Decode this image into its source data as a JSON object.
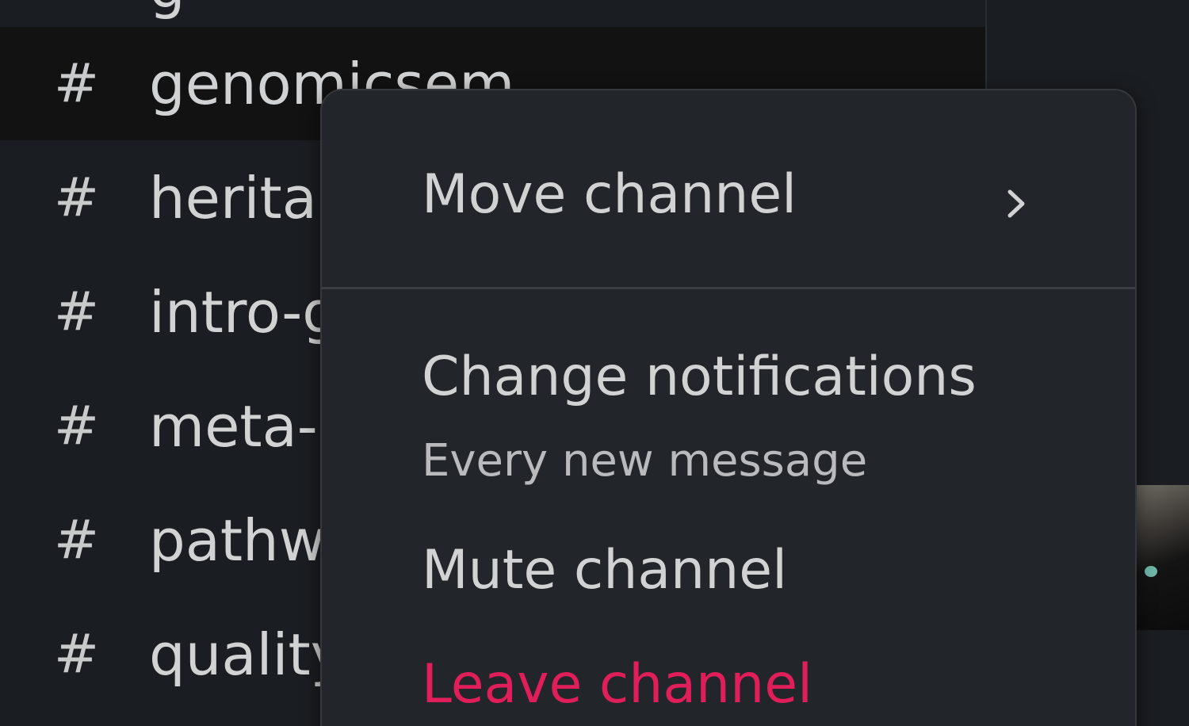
{
  "sidebar": {
    "partial_top_channel": "g",
    "channels": [
      {
        "hash": "#",
        "name": "genomicsem",
        "active": true
      },
      {
        "hash": "#",
        "name": "heritab"
      },
      {
        "hash": "#",
        "name": "intro-g"
      },
      {
        "hash": "#",
        "name": "meta-a"
      },
      {
        "hash": "#",
        "name": "pathwa"
      },
      {
        "hash": "#",
        "name": "quality"
      }
    ]
  },
  "context_menu": {
    "move_channel": "Move channel",
    "move_channel_icon": "chevron-right-icon",
    "change_notifications": "Change notifications",
    "notifications_value": "Every new message",
    "mute_channel": "Mute channel",
    "leave_channel": "Leave channel"
  },
  "colors": {
    "background": "#1a1d21",
    "menu_background": "#222529",
    "text": "#d1d2d3",
    "danger": "#e01e5a",
    "active_row": "#121212"
  }
}
